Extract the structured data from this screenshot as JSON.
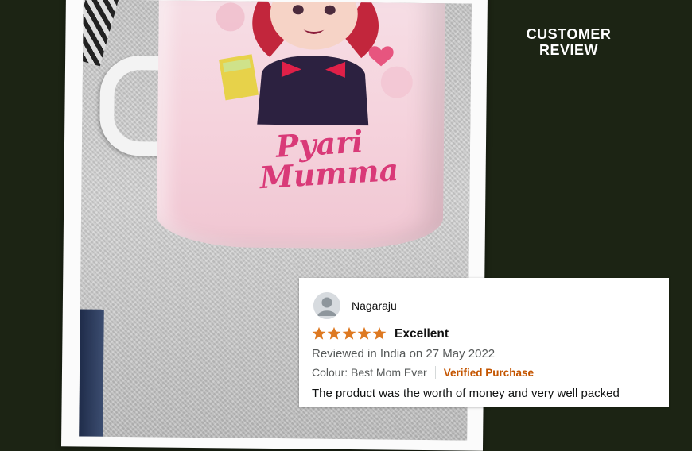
{
  "header": {
    "title_line1": "CUSTOMER",
    "title_line2": "REVIEW"
  },
  "photo": {
    "mug_text_line1": "Pyari",
    "mug_text_line2": "Mumma"
  },
  "review": {
    "reviewer_name": "Nagaraju",
    "rating": 5,
    "rating_max": 5,
    "title": "Excellent",
    "meta": "Reviewed in India on 27 May 2022",
    "variant": "Colour: Best Mom Ever",
    "verified": "Verified Purchase",
    "body": "The product was the worth of money and very well packed"
  },
  "colors": {
    "background": "#1c2414",
    "star": "#de7921",
    "verified": "#c45500",
    "mug_text": "#d93a78"
  },
  "icons": {
    "avatar": "user-avatar-icon",
    "star": "star-icon"
  }
}
